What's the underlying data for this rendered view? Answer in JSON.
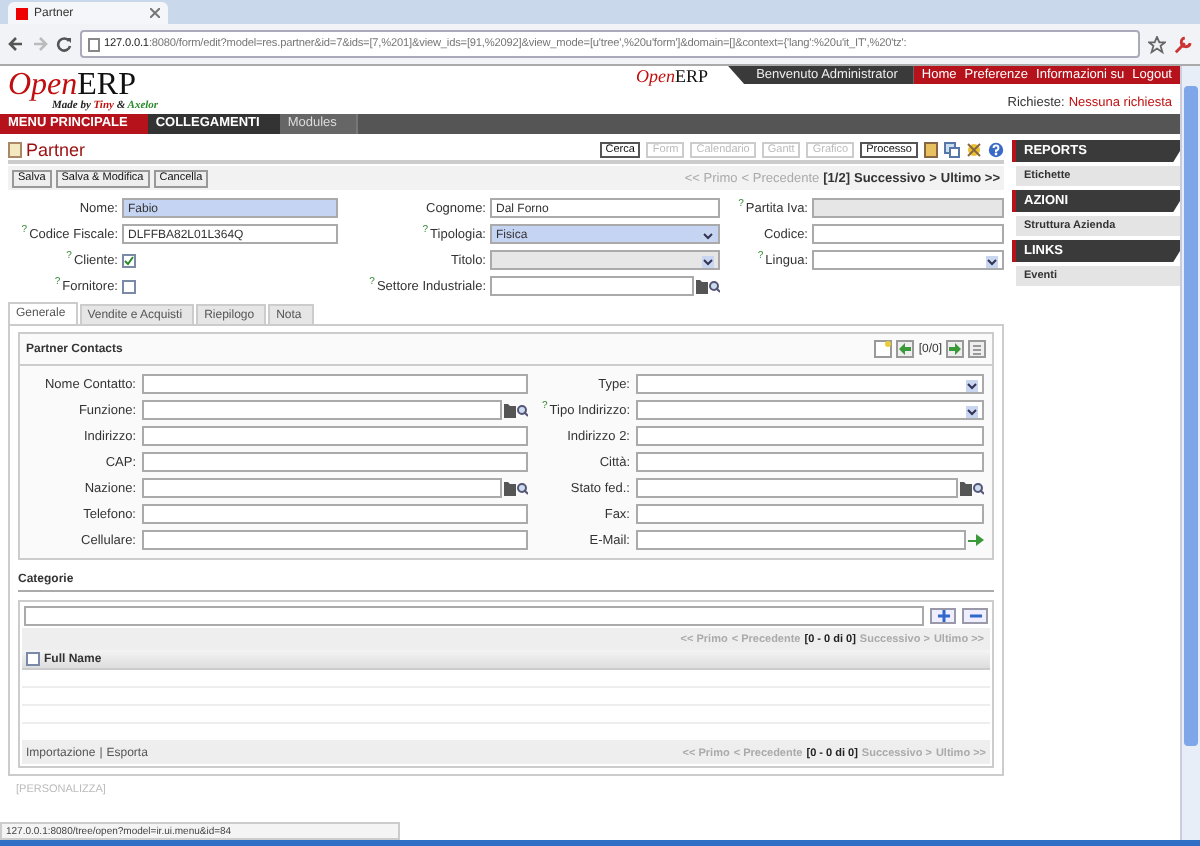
{
  "browser": {
    "tab_title": "Partner",
    "url_host": "127.0.0.1",
    "url_rest": ":8080/form/edit?model=res.partner&id=7&ids=[7,%201]&view_ids=[91,%2092]&view_mode=[u'tree',%20u'form']&domain=[]&context={'lang':%20u'it_IT',%20'tz':"
  },
  "header": {
    "logo_open": "Open",
    "logo_erp": "ERP",
    "tagline": [
      "Made by",
      "Tiny",
      "&",
      "Axelor"
    ],
    "small_logo_open": "Open",
    "small_logo_erp": "ERP",
    "welcome": "Benvenuto Administrator",
    "links": [
      "Home",
      "Preferenze",
      "Informazioni su",
      "Logout"
    ],
    "requests_label": "Richieste:",
    "requests_value": "Nessuna richiesta"
  },
  "menu": [
    {
      "label": "MENU PRINCIPALE",
      "selected": true
    },
    {
      "label": "COLLEGAMENTI",
      "selected": false
    },
    {
      "label": "Modules",
      "selected": false
    }
  ],
  "page_title": "Partner",
  "views": [
    {
      "label": "Cerca",
      "disabled": false
    },
    {
      "label": "Form",
      "disabled": true
    },
    {
      "label": "Calendario",
      "disabled": true
    },
    {
      "label": "Gantt",
      "disabled": true
    },
    {
      "label": "Grafico",
      "disabled": true
    },
    {
      "label": "Processo",
      "disabled": false
    }
  ],
  "actions": [
    "Salva",
    "Salva & Modifica",
    "Cancella"
  ],
  "pager": [
    {
      "text": "<< Primo",
      "disabled": true
    },
    {
      "text": "< Precedente",
      "disabled": true
    },
    {
      "text": "[1/2]",
      "disabled": false
    },
    {
      "text": "Successivo >",
      "disabled": false
    },
    {
      "text": "Ultimo >>",
      "disabled": false
    }
  ],
  "help_mark": "?",
  "form_rows": [
    [
      {
        "label": "Nome:",
        "kind": "text",
        "value": "Fabio",
        "help": false,
        "required": true,
        "disabled": false
      },
      {
        "label": "Cognome:",
        "kind": "text",
        "value": "Dal Forno",
        "help": false,
        "required": false,
        "disabled": false
      },
      {
        "label": "Partita Iva:",
        "kind": "text",
        "help": true,
        "required": false,
        "disabled": true
      }
    ],
    [
      {
        "label": "Codice Fiscale:",
        "kind": "text",
        "value": "DLFFBA82L01L364Q",
        "help": true,
        "required": false,
        "disabled": false
      },
      {
        "label": "Tipologia:",
        "kind": "select",
        "value": "Fisica",
        "help": true,
        "required": true,
        "disabled": false
      },
      {
        "label": "Codice:",
        "kind": "text",
        "help": false,
        "required": false,
        "disabled": false
      }
    ],
    [
      {
        "label": "Cliente:",
        "kind": "check",
        "checked": true,
        "help": true
      },
      {
        "label": "Titolo:",
        "kind": "select",
        "help": false,
        "required": false,
        "disabled": true
      },
      {
        "label": "Lingua:",
        "kind": "select",
        "help": true,
        "required": false,
        "disabled": false
      }
    ],
    [
      {
        "label": "Fornitore:",
        "kind": "check",
        "checked": false,
        "help": true
      },
      {
        "label": "Settore Industriale:",
        "kind": "m2o",
        "help": true,
        "required": false,
        "disabled": false
      }
    ]
  ],
  "tabs": [
    {
      "label": "Generale",
      "selected": true
    },
    {
      "label": "Vendite e Acquisti",
      "selected": false
    },
    {
      "label": "Riepilogo",
      "selected": false
    },
    {
      "label": "Nota",
      "selected": false
    }
  ],
  "contacts": {
    "title": "Partner Contacts",
    "counter": "[0/0]",
    "rows": [
      [
        {
          "label": "Nome Contatto:",
          "kind": "text",
          "help": false
        },
        {
          "label": "Type:",
          "kind": "select",
          "help": false
        }
      ],
      [
        {
          "label": "Funzione:",
          "kind": "m2o",
          "help": false
        },
        {
          "label": "Tipo Indirizzo:",
          "kind": "select",
          "help": true
        }
      ],
      [
        {
          "label": "Indirizzo:",
          "kind": "text",
          "help": false
        },
        {
          "label": "Indirizzo 2:",
          "kind": "text",
          "help": false
        }
      ],
      [
        {
          "label": "CAP:",
          "kind": "text",
          "help": false
        },
        {
          "label": "Città:",
          "kind": "text",
          "help": false
        }
      ],
      [
        {
          "label": "Nazione:",
          "kind": "m2o",
          "help": false
        },
        {
          "label": "Stato fed.:",
          "kind": "m2o",
          "help": false
        }
      ],
      [
        {
          "label": "Telefono:",
          "kind": "text",
          "help": false
        },
        {
          "label": "Fax:",
          "kind": "text",
          "help": false
        }
      ],
      [
        {
          "label": "Cellulare:",
          "kind": "text",
          "help": false
        },
        {
          "label": "E-Mail:",
          "kind": "email",
          "help": false
        }
      ]
    ]
  },
  "categories": {
    "title": "Categorie",
    "pager": [
      "<< Primo",
      "< Precedente",
      "[0 - 0 di 0]",
      "Successivo >",
      "Ultimo >>"
    ],
    "column": "Full Name",
    "all_checked": false,
    "footer_links": [
      "Importazione",
      "|",
      "Esporta"
    ],
    "footer_pager": [
      "<< Primo",
      "< Precedente",
      "[0 - 0 di 0]",
      "Successivo >",
      "Ultimo >>"
    ]
  },
  "customize": "[PERSONALIZZA]",
  "sidebar": [
    {
      "title": "REPORTS",
      "items": [
        "Etichette"
      ]
    },
    {
      "title": "AZIONI",
      "items": [
        "Struttura Azienda"
      ]
    },
    {
      "title": "LINKS",
      "items": [
        "Eventi"
      ]
    }
  ],
  "status_url": "127.0.0.1:8080/tree/open?model=ir.ui.menu&id=84"
}
